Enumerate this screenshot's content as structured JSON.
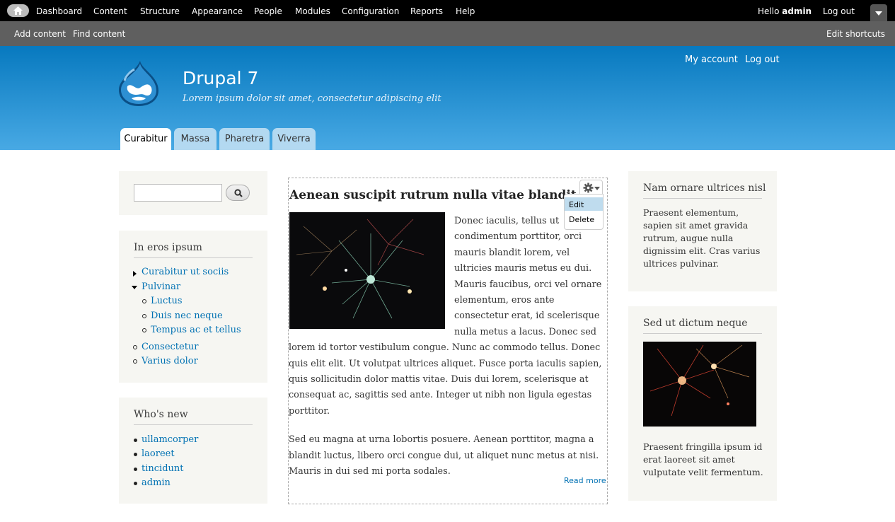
{
  "toolbar": {
    "menu": [
      "Dashboard",
      "Content",
      "Structure",
      "Appearance",
      "People",
      "Modules",
      "Configuration",
      "Reports",
      "Help"
    ],
    "hello": "Hello",
    "user": "admin",
    "logout": "Log out"
  },
  "shortcuts": {
    "items": [
      "Add content",
      "Find content"
    ],
    "edit": "Edit shortcuts"
  },
  "header": {
    "site_name": "Drupal 7",
    "slogan": "Lorem ipsum dolor sit amet, consectetur adipiscing elit",
    "secondary": [
      "My account",
      "Log out"
    ],
    "tabs": [
      "Curabitur",
      "Massa",
      "Pharetra",
      "Viverra"
    ]
  },
  "sidebar_first": {
    "block1": {
      "title": "In eros ipsum",
      "items": [
        "Curabitur ut sociis",
        "Pulvinar",
        "Luctus",
        "Duis nec neque",
        "Tempus ac et tellus",
        "Consectetur",
        "Varius dolor"
      ]
    },
    "block2": {
      "title": "Who's new",
      "items": [
        "ullamcorper",
        "laoreet",
        "tincidunt",
        "admin"
      ]
    }
  },
  "main": {
    "title": "Aenean suscipit rutrum nulla vitae blandit",
    "para1": "Donec iaculis, tellus ut condimentum porttitor, orci mauris blandit lorem, vel ultricies mauris metus eu dui. Mauris faucibus, orci vel ornare elementum, eros ante consectetur erat, id scelerisque nulla metus a lacus. Donec sed lorem id tortor vestibulum congue. Nunc ac commodo tellus. Donec quis elit elit. Ut volutpat ultrices aliquet. Fusce porta iaculis sapien, quis sollicitudin dolor mattis vitae. Duis dui lorem, scelerisque at consequat ac, sagittis sed ante. Integer ut nibh non ligula egestas porttitor.",
    "para2": "Sed eu magna at urna lobortis posuere. Aenean porttitor, magna a blandit luctus, libero orci congue dui, ut aliquet nunc metus at nisi. Mauris in dui sed mi porta sodales.",
    "read_more": "Read more",
    "contextual": [
      "Edit",
      "Delete"
    ]
  },
  "sidebar_second": {
    "block1": {
      "title": "Nam ornare ultrices nisl",
      "text": "Praesent elementum, sapien sit amet gravida rutrum, augue nulla dignissim elit. Cras varius ultrices pulvinar."
    },
    "block2": {
      "title": "Sed ut dictum neque",
      "text": "Praesent fringilla ipsum id erat laoreet sit amet vulputate velit fermentum."
    }
  },
  "colors": {
    "link": "#0071b3",
    "header_top": "#0779bf",
    "header_bottom": "#48a9e4",
    "block_bg": "#f6f6f2"
  }
}
